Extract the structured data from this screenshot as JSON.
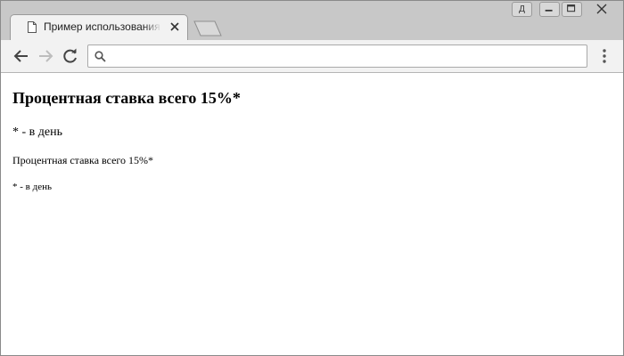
{
  "browser": {
    "tab": {
      "title": "Пример использования эле",
      "icon": "document-icon"
    },
    "window_controls": {
      "profile_label": "Д"
    },
    "toolbar": {
      "address_value": "",
      "address_placeholder": ""
    }
  },
  "page": {
    "heading": "Процентная ставка всего 15%*",
    "note_large": "* - в день",
    "text_small": "Процентная ставка всего 15%*",
    "note_small": "* - в день"
  }
}
